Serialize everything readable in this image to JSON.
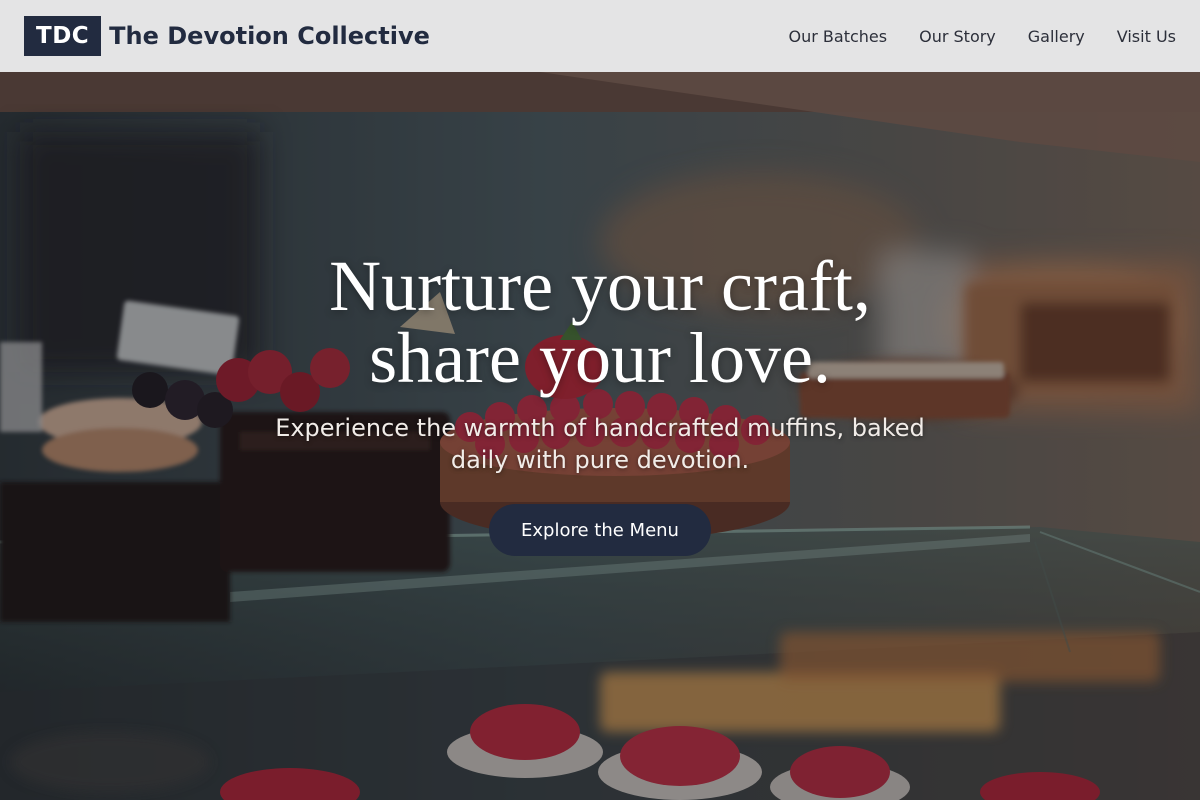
{
  "header": {
    "logo_text": "TDC",
    "brand_name": "The Devotion Collective",
    "nav": [
      {
        "label": "Our Batches"
      },
      {
        "label": "Our Story"
      },
      {
        "label": "Gallery"
      },
      {
        "label": "Visit Us"
      }
    ]
  },
  "hero": {
    "headline_line1": "Nurture your craft,",
    "headline_line2": "share your love.",
    "subtitle": "Experience the warmth of handcrafted muffins, baked daily with pure devotion.",
    "cta_label": "Explore the Menu",
    "background_image": "bakery-display-case-photo"
  },
  "colors": {
    "navy": "#222b40",
    "header_bg": "#e4e4e5",
    "text_white": "#ffffff"
  }
}
